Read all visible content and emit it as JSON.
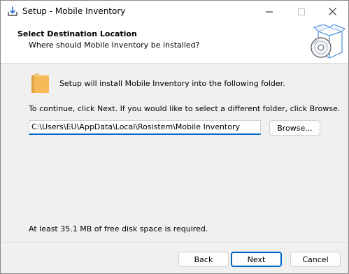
{
  "window": {
    "title": "Setup - Mobile Inventory"
  },
  "header": {
    "title": "Select Destination Location",
    "subtitle": "Where should Mobile Inventory be installed?"
  },
  "body": {
    "intro": "Setup will install Mobile Inventory into the following folder.",
    "instruction": "To continue, click Next. If you would like to select a different folder, click Browse.",
    "path_value": "C:\\Users\\EU\\AppData\\Local\\Rosistem\\Mobile Inventory",
    "browse_label": "Browse...",
    "disk_space": "At least 35.1 MB of free disk space is required."
  },
  "footer": {
    "back_label": "Back",
    "next_label": "Next",
    "cancel_label": "Cancel"
  },
  "colors": {
    "accent": "#0067c0",
    "window_bg": "#f0f0f0",
    "header_bg": "#ffffff",
    "folder": "#f5b957"
  },
  "icons": {
    "title": "installer-download-icon",
    "header": "software-box-disc-icon",
    "folder": "folder-icon"
  }
}
